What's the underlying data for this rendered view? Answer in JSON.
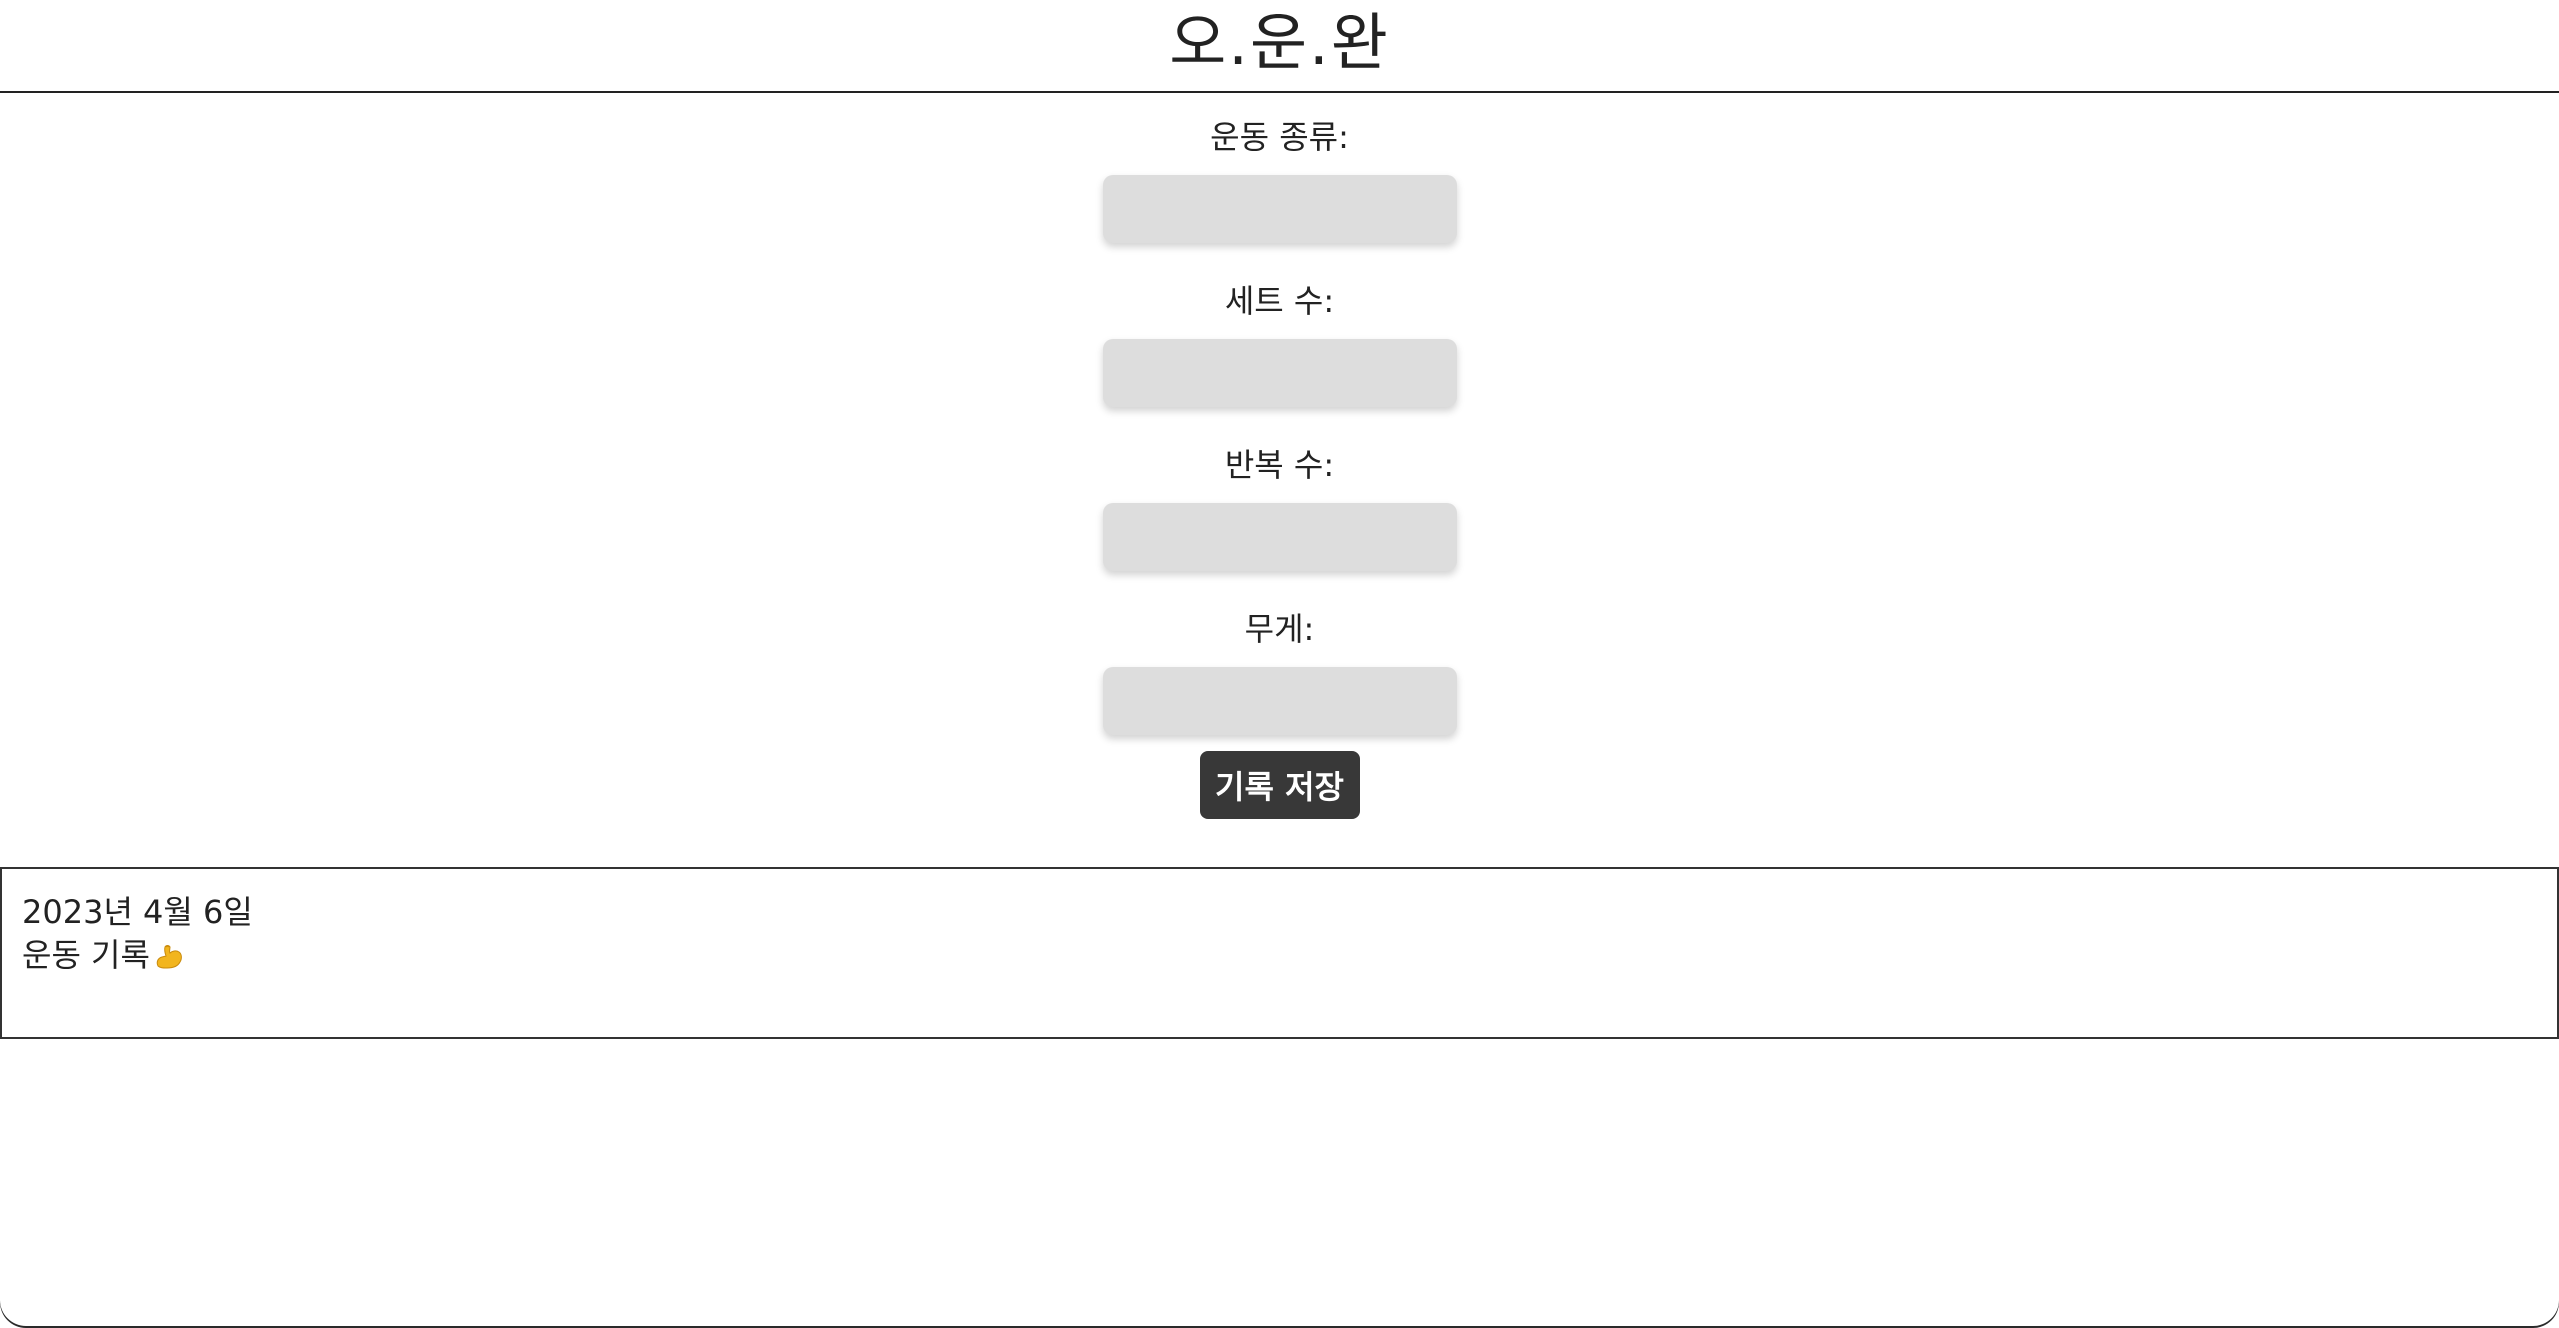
{
  "app": {
    "title": "오.운.완"
  },
  "form": {
    "fields": [
      {
        "label": "운동 종류:",
        "value": "",
        "placeholder": ""
      },
      {
        "label": "세트 수:",
        "value": "",
        "placeholder": ""
      },
      {
        "label": "반복 수:",
        "value": "",
        "placeholder": ""
      },
      {
        "label": "무게:",
        "value": "",
        "placeholder": ""
      }
    ],
    "save_label": "기록 저장"
  },
  "record": {
    "date": "2023년 4월 6일",
    "title": "운동 기록",
    "icon": "flexed-biceps-icon"
  },
  "colors": {
    "input_bg": "#dddddd",
    "button_bg": "#383838",
    "button_text": "#ffffff"
  }
}
